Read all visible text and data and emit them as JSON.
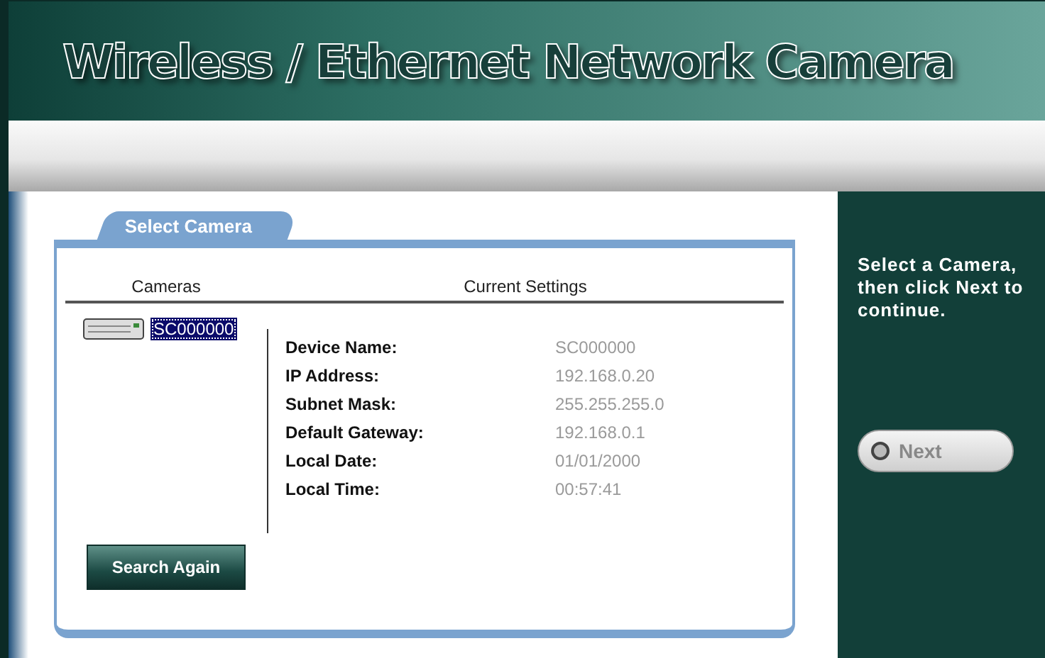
{
  "header": {
    "title": "Wireless / Ethernet Network Camera"
  },
  "panel": {
    "tab": "Select Camera",
    "cameras_heading": "Cameras",
    "settings_heading": "Current Settings",
    "cameras": [
      {
        "name": "SC000000",
        "selected": true
      }
    ],
    "settings": [
      {
        "label": "Device Name:",
        "value": "SC000000"
      },
      {
        "label": "IP Address:",
        "value": "192.168.0.20"
      },
      {
        "label": "Subnet Mask:",
        "value": "255.255.255.0"
      },
      {
        "label": "Default Gateway:",
        "value": "192.168.0.1"
      },
      {
        "label": "Local Date:",
        "value": "01/01/2000"
      },
      {
        "label": "Local Time:",
        "value": "00:57:41"
      }
    ],
    "search_button": "Search Again"
  },
  "sidebar": {
    "instructions": "Select a Camera, then click Next to continue.",
    "next_button": "Next"
  }
}
